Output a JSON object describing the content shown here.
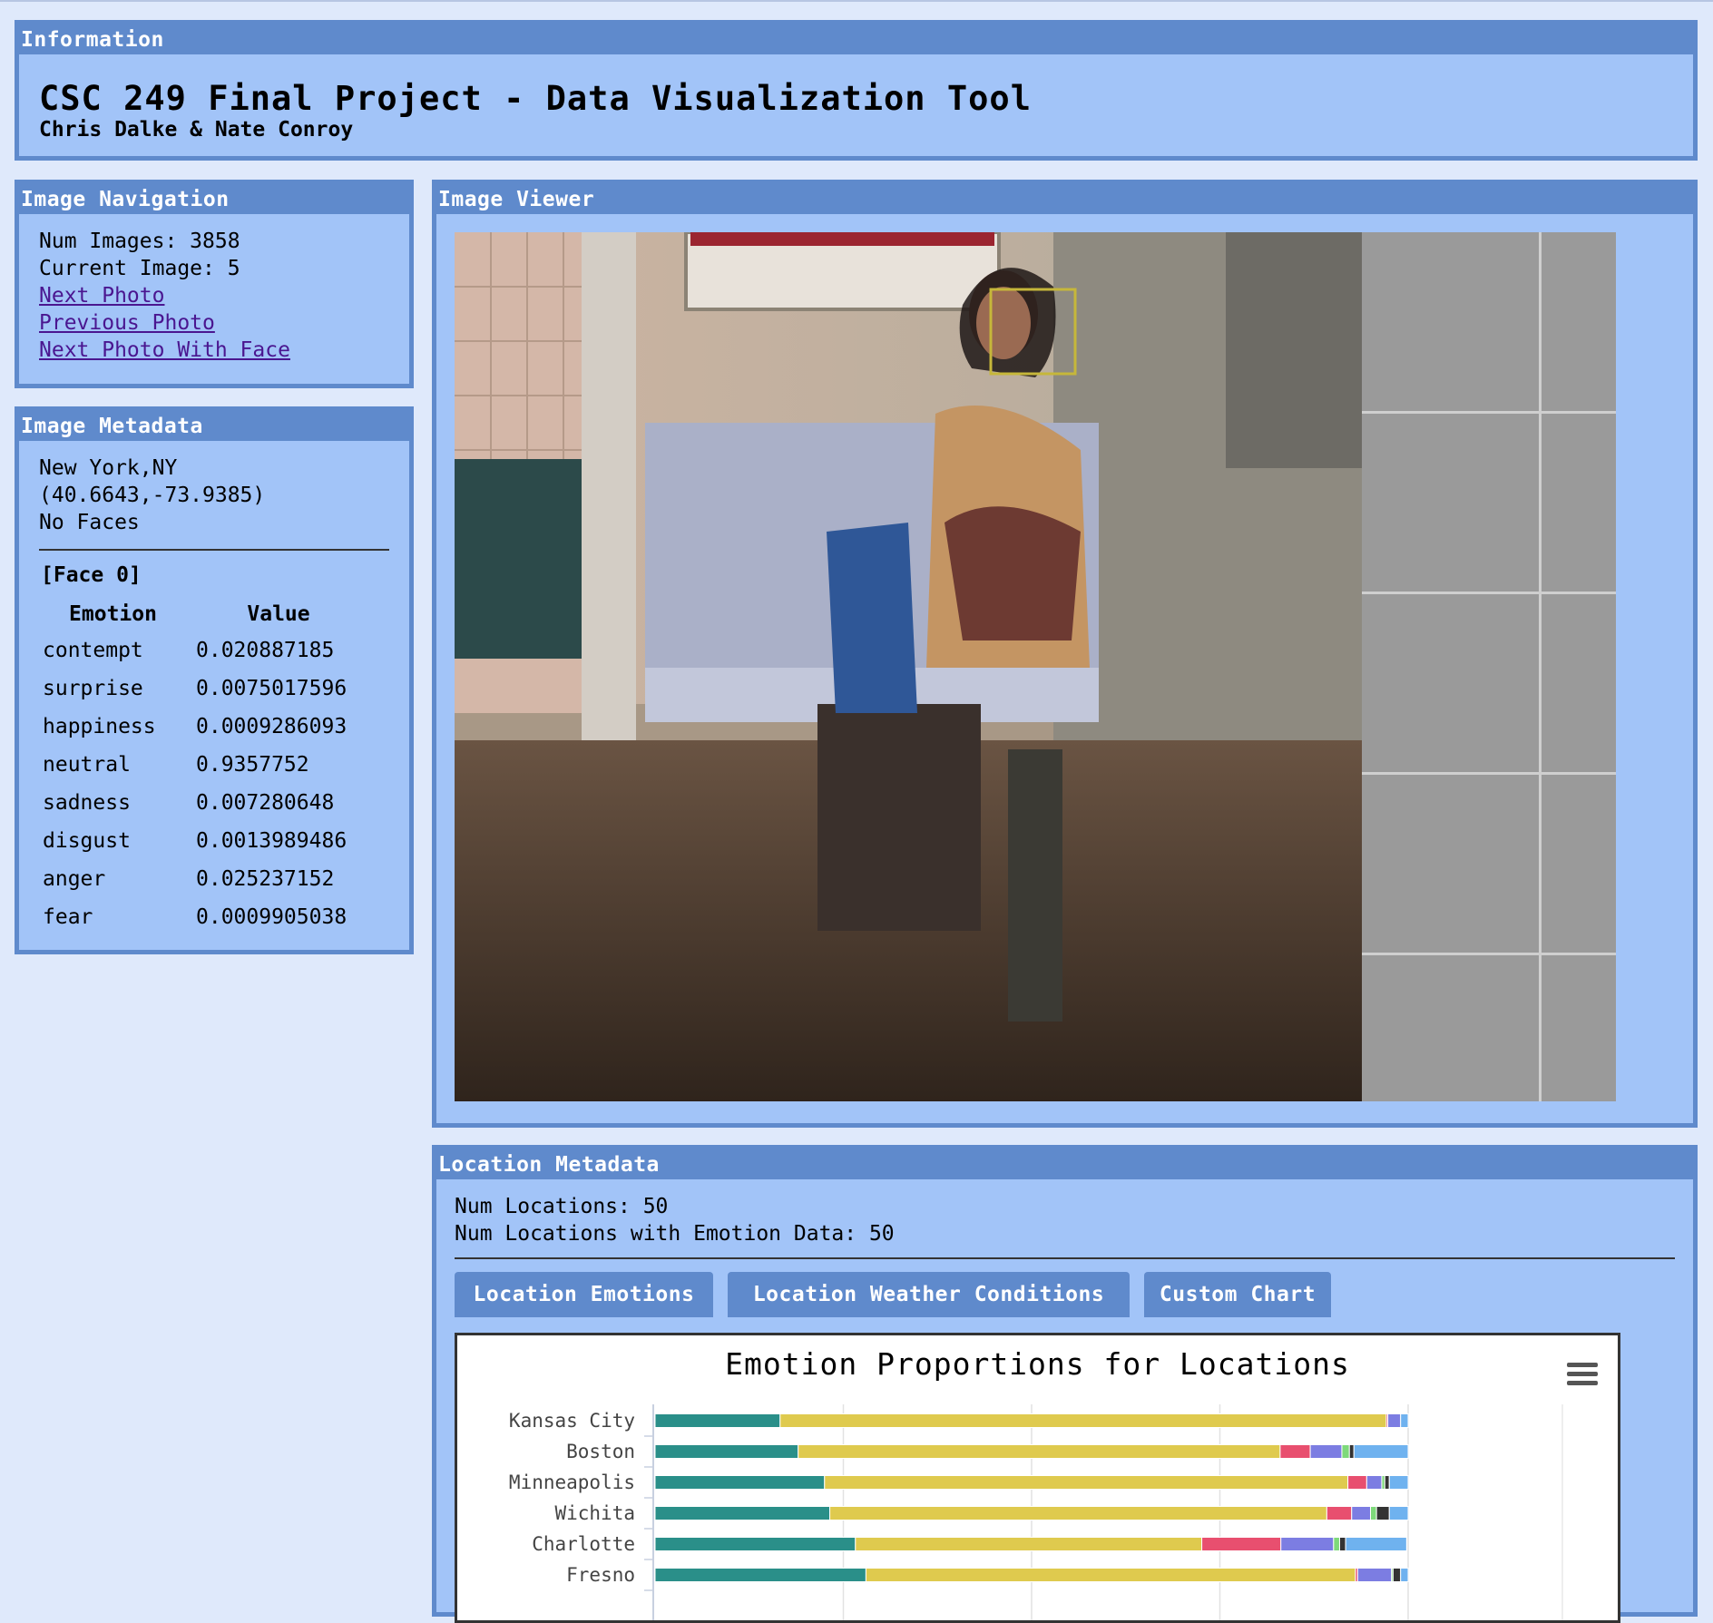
{
  "info": {
    "header": "Information",
    "title": "CSC 249 Final Project - Data Visualization Tool",
    "authors": "Chris Dalke & Nate Conroy"
  },
  "navigation": {
    "header": "Image Navigation",
    "num_images_label": "Num Images: 3858",
    "current_image_label": "Current Image: 5",
    "links": [
      "Next Photo",
      "Previous Photo",
      "Next Photo With Face"
    ]
  },
  "metadata": {
    "header": "Image Metadata",
    "location": "New York,NY",
    "coords": "(40.6643,-73.9385)",
    "faces_note": "No Faces",
    "face_label": "[Face 0]",
    "columns": [
      "Emotion",
      "Value"
    ],
    "rows": [
      {
        "emotion": "contempt",
        "value": "0.020887185"
      },
      {
        "emotion": "surprise",
        "value": "0.0075017596"
      },
      {
        "emotion": "happiness",
        "value": "0.0009286093"
      },
      {
        "emotion": "neutral",
        "value": "0.9357752"
      },
      {
        "emotion": "sadness",
        "value": "0.007280648"
      },
      {
        "emotion": "disgust",
        "value": "0.0013989486"
      },
      {
        "emotion": "anger",
        "value": "0.025237152"
      },
      {
        "emotion": "fear",
        "value": "0.0009905038"
      }
    ]
  },
  "viewer": {
    "header": "Image Viewer"
  },
  "location": {
    "header": "Location Metadata",
    "num_locations": "Num Locations: 50",
    "num_with_emotion": "Num Locations with Emotion Data: 50",
    "tabs": [
      "Location Emotions",
      "Location Weather Conditions",
      "Custom Chart"
    ]
  },
  "colors": {
    "panel_bg": "#a2c4f8",
    "panel_header": "#5f8acc",
    "page_bg": "#dfe9fb",
    "link": "#4a1690"
  },
  "chart_data": {
    "type": "bar",
    "orientation": "horizontal",
    "stacked": true,
    "title": "Emotion Proportions for Locations",
    "categories": [
      "Kansas City",
      "Boston",
      "Minneapolis",
      "Wichita",
      "Charlotte",
      "Fresno"
    ],
    "series": [
      {
        "color": "#2a8f89",
        "values": [
          0.166,
          0.19,
          0.225,
          0.232,
          0.266,
          0.28
        ]
      },
      {
        "color": "#dfca4e",
        "values": [
          0.805,
          0.64,
          0.695,
          0.66,
          0.46,
          0.65
        ]
      },
      {
        "color": "#e84f6f",
        "values": [
          0.002,
          0.04,
          0.025,
          0.033,
          0.105,
          0.003
        ]
      },
      {
        "color": "#7c7de2",
        "values": [
          0.017,
          0.042,
          0.02,
          0.025,
          0.07,
          0.045
        ]
      },
      {
        "color": "#7ed97a",
        "values": [
          0.0,
          0.01,
          0.004,
          0.008,
          0.008,
          0.002
        ]
      },
      {
        "color": "#333333",
        "values": [
          0.0,
          0.006,
          0.006,
          0.017,
          0.008,
          0.01
        ]
      },
      {
        "color": "#6fb2ef",
        "values": [
          0.01,
          0.072,
          0.025,
          0.025,
          0.081,
          0.01
        ]
      }
    ],
    "xlim": [
      0,
      1
    ],
    "grid": true,
    "legend": "none visible"
  }
}
